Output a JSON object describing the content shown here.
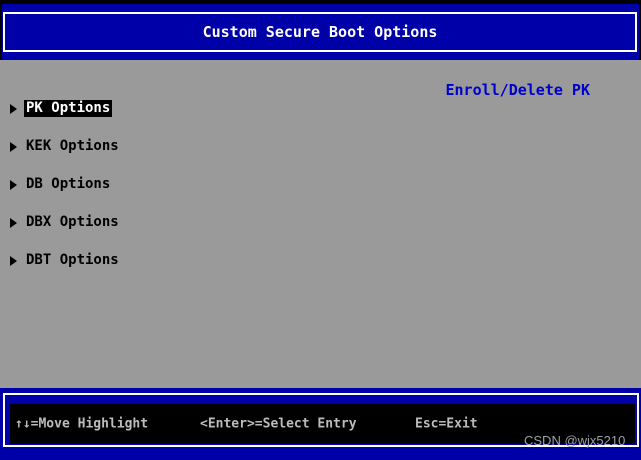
{
  "title_bar": {
    "title": "Custom Secure Boot Options"
  },
  "main": {
    "help_text": "Enroll/Delete PK",
    "menu_items": [
      {
        "label": "PK Options",
        "selected": true
      },
      {
        "label": "KEK Options",
        "selected": false
      },
      {
        "label": "DB Options",
        "selected": false
      },
      {
        "label": "DBX Options",
        "selected": false
      },
      {
        "label": "DBT Options",
        "selected": false
      }
    ]
  },
  "footer": {
    "keys": [
      {
        "label": "↑↓=Move Highlight"
      },
      {
        "label": "<Enter>=Select Entry"
      },
      {
        "label": "Esc=Exit"
      }
    ]
  },
  "watermark": "CSDN @wjx5210",
  "colors": {
    "header_blue": "#0000a8",
    "background_gray": "#9a9a9a",
    "help_text_blue": "#0000cc",
    "key_hint_gray": "#bcbcbc",
    "highlight_bg": "#000000",
    "highlight_fg": "#ffffff"
  }
}
